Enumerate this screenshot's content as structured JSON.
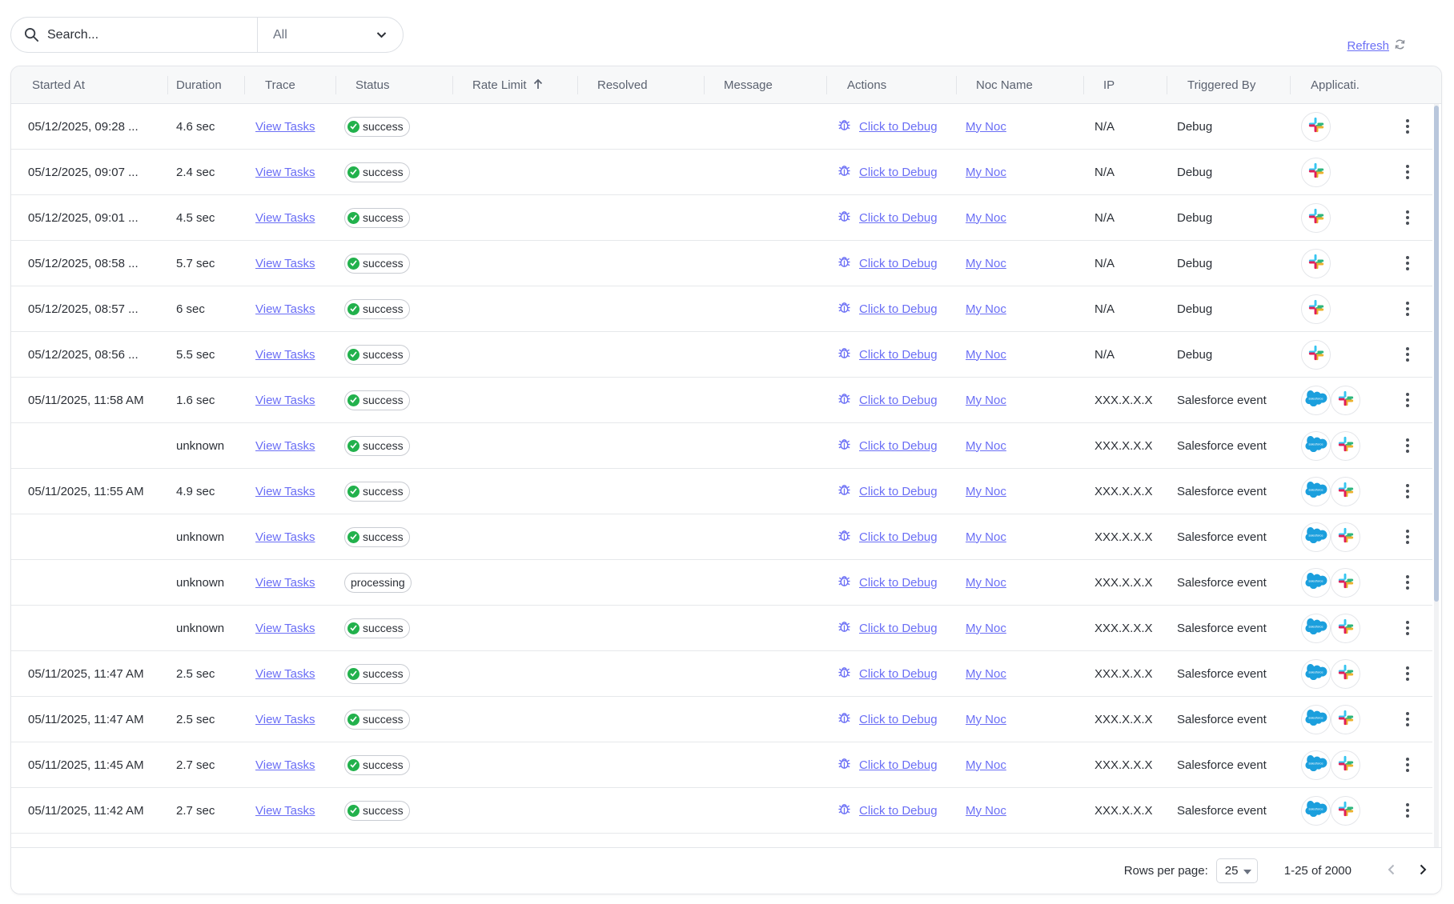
{
  "search": {
    "placeholder": "Search...",
    "filter_value": "All"
  },
  "refresh_label": "Refresh",
  "columns": [
    "Started At",
    "Duration",
    "Trace",
    "Status",
    "Rate Limit",
    "Resolved",
    "Message",
    "Actions",
    "Noc Name",
    "IP",
    "Triggered By",
    "Applicati."
  ],
  "sort": {
    "column": "Rate Limit",
    "direction": "ascending"
  },
  "rows": [
    {
      "started_at": "05/12/2025, 09:28 ...",
      "duration": "4.6 sec",
      "trace": "View Tasks",
      "status": "success",
      "action": "Click to Debug",
      "noc": "My Noc",
      "ip": "N/A",
      "triggered_by": "Debug",
      "apps": [
        "slack"
      ]
    },
    {
      "started_at": "05/12/2025, 09:07 ...",
      "duration": "2.4 sec",
      "trace": "View Tasks",
      "status": "success",
      "action": "Click to Debug",
      "noc": "My Noc",
      "ip": "N/A",
      "triggered_by": "Debug",
      "apps": [
        "slack"
      ]
    },
    {
      "started_at": "05/12/2025, 09:01 ...",
      "duration": "4.5 sec",
      "trace": "View Tasks",
      "status": "success",
      "action": "Click to Debug",
      "noc": "My Noc",
      "ip": "N/A",
      "triggered_by": "Debug",
      "apps": [
        "slack"
      ]
    },
    {
      "started_at": "05/12/2025, 08:58 ...",
      "duration": "5.7 sec",
      "trace": "View Tasks",
      "status": "success",
      "action": "Click to Debug",
      "noc": "My Noc",
      "ip": "N/A",
      "triggered_by": "Debug",
      "apps": [
        "slack"
      ]
    },
    {
      "started_at": "05/12/2025, 08:57 ...",
      "duration": "6 sec",
      "trace": "View Tasks",
      "status": "success",
      "action": "Click to Debug",
      "noc": "My Noc",
      "ip": "N/A",
      "triggered_by": "Debug",
      "apps": [
        "slack"
      ]
    },
    {
      "started_at": "05/12/2025, 08:56 ...",
      "duration": "5.5 sec",
      "trace": "View Tasks",
      "status": "success",
      "action": "Click to Debug",
      "noc": "My Noc",
      "ip": "N/A",
      "triggered_by": "Debug",
      "apps": [
        "slack"
      ]
    },
    {
      "started_at": "05/11/2025, 11:58 AM",
      "duration": "1.6 sec",
      "trace": "View Tasks",
      "status": "success",
      "action": "Click to Debug",
      "noc": "My Noc",
      "ip": "XXX.X.X.X",
      "triggered_by": "Salesforce event",
      "apps": [
        "salesforce",
        "slack"
      ]
    },
    {
      "started_at": "",
      "duration": "unknown",
      "trace": "View Tasks",
      "status": "success",
      "action": "Click to Debug",
      "noc": "My Noc",
      "ip": "XXX.X.X.X",
      "triggered_by": "Salesforce event",
      "apps": [
        "salesforce",
        "slack"
      ]
    },
    {
      "started_at": "05/11/2025, 11:55 AM",
      "duration": "4.9 sec",
      "trace": "View Tasks",
      "status": "success",
      "action": "Click to Debug",
      "noc": "My Noc",
      "ip": "XXX.X.X.X",
      "triggered_by": "Salesforce event",
      "apps": [
        "salesforce",
        "slack"
      ]
    },
    {
      "started_at": "",
      "duration": "unknown",
      "trace": "View Tasks",
      "status": "success",
      "action": "Click to Debug",
      "noc": "My Noc",
      "ip": "XXX.X.X.X",
      "triggered_by": "Salesforce event",
      "apps": [
        "salesforce",
        "slack"
      ]
    },
    {
      "started_at": "",
      "duration": "unknown",
      "trace": "View Tasks",
      "status": "processing",
      "action": "Click to Debug",
      "noc": "My Noc",
      "ip": "XXX.X.X.X",
      "triggered_by": "Salesforce event",
      "apps": [
        "salesforce",
        "slack"
      ]
    },
    {
      "started_at": "",
      "duration": "unknown",
      "trace": "View Tasks",
      "status": "success",
      "action": "Click to Debug",
      "noc": "My Noc",
      "ip": "XXX.X.X.X",
      "triggered_by": "Salesforce event",
      "apps": [
        "salesforce",
        "slack"
      ]
    },
    {
      "started_at": "05/11/2025, 11:47 AM",
      "duration": "2.5 sec",
      "trace": "View Tasks",
      "status": "success",
      "action": "Click to Debug",
      "noc": "My Noc",
      "ip": "XXX.X.X.X",
      "triggered_by": "Salesforce event",
      "apps": [
        "salesforce",
        "slack"
      ]
    },
    {
      "started_at": "05/11/2025, 11:47 AM",
      "duration": "2.5 sec",
      "trace": "View Tasks",
      "status": "success",
      "action": "Click to Debug",
      "noc": "My Noc",
      "ip": "XXX.X.X.X",
      "triggered_by": "Salesforce event",
      "apps": [
        "salesforce",
        "slack"
      ]
    },
    {
      "started_at": "05/11/2025, 11:45 AM",
      "duration": "2.7 sec",
      "trace": "View Tasks",
      "status": "success",
      "action": "Click to Debug",
      "noc": "My Noc",
      "ip": "XXX.X.X.X",
      "triggered_by": "Salesforce event",
      "apps": [
        "salesforce",
        "slack"
      ]
    },
    {
      "started_at": "05/11/2025, 11:42 AM",
      "duration": "2.7 sec",
      "trace": "View Tasks",
      "status": "success",
      "action": "Click to Debug",
      "noc": "My Noc",
      "ip": "XXX.X.X.X",
      "triggered_by": "Salesforce event",
      "apps": [
        "salesforce",
        "slack"
      ]
    }
  ],
  "footer": {
    "rows_per_page_label": "Rows per page:",
    "rows_per_page_value": "25",
    "range": "1-25 of 2000"
  },
  "colors": {
    "link": "#6a6ef5",
    "success": "#22b14c",
    "header_bg": "#f7f8f9",
    "border": "#e3e5e9"
  },
  "icons": {
    "search": "search-icon",
    "filter": "chevron-down-icon",
    "refresh": "refresh-icon",
    "sort": "arrow-up-icon",
    "debug": "bug-icon",
    "status": "check-circle-icon",
    "apps": [
      "slack-icon",
      "salesforce-icon"
    ],
    "row_menu": "kebab-menu-icon",
    "prev": "chevron-left-icon",
    "next": "chevron-right-icon"
  }
}
